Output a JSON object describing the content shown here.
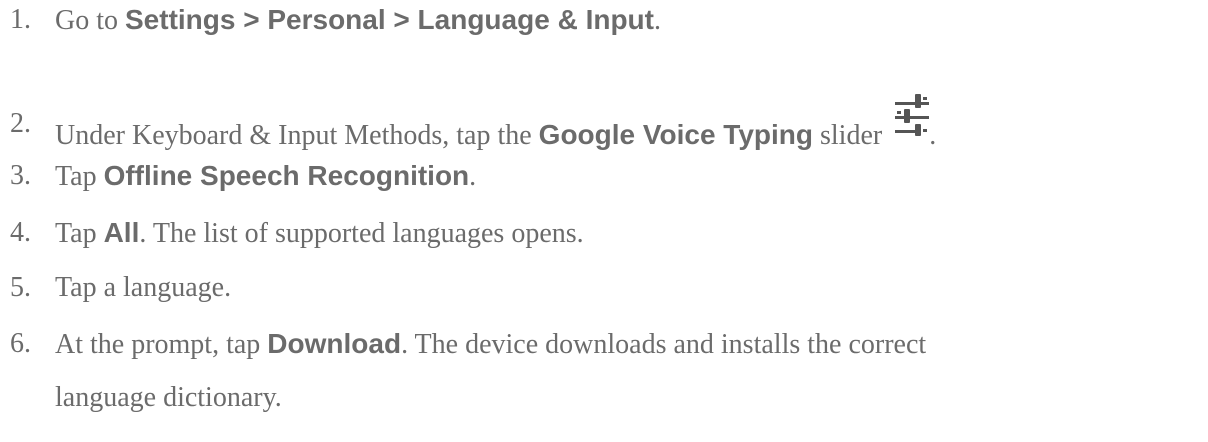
{
  "steps": [
    {
      "number": "1.",
      "parts": [
        {
          "t": "Go to ",
          "b": false
        },
        {
          "t": "Settings > Personal > Language & Input",
          "b": true
        },
        {
          "t": ".",
          "b": false
        }
      ]
    },
    {
      "number": "2.",
      "parts": [
        {
          "t": "Under Keyboard & Input Methods, tap the ",
          "b": false
        },
        {
          "t": "Google Voice Typing",
          "b": true
        },
        {
          "t": " slider ",
          "b": false
        }
      ],
      "icon": "sliders-icon",
      "after_icon": "."
    },
    {
      "number": "3.",
      "parts": [
        {
          "t": "Tap ",
          "b": false
        },
        {
          "t": "Offline Speech Recognition",
          "b": true
        },
        {
          "t": ".",
          "b": false
        }
      ]
    },
    {
      "number": "4.",
      "parts": [
        {
          "t": "Tap ",
          "b": false
        },
        {
          "t": "All",
          "b": true
        },
        {
          "t": ". The list of supported languages opens.",
          "b": false
        }
      ]
    },
    {
      "number": "5.",
      "parts": [
        {
          "t": "Tap a language.",
          "b": false
        }
      ]
    },
    {
      "number": "6.",
      "parts": [
        {
          "t": "At the prompt, tap ",
          "b": false
        },
        {
          "t": "Download",
          "b": true
        },
        {
          "t": ". The device downloads and installs the correct",
          "b": false
        }
      ],
      "continuation": "language dictionary."
    }
  ]
}
